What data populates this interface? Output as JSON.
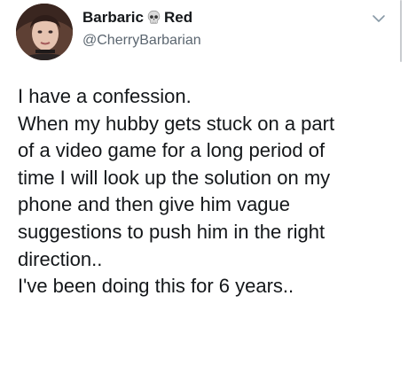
{
  "user": {
    "display_name_first": "Barbaric",
    "display_name_second": "Red",
    "handle": "@CherryBarbarian",
    "name_emoji": "skull-icon"
  },
  "tweet": {
    "lines": [
      "I have a confession.",
      "When my hubby gets stuck on a part",
      "of a video game for a long period of",
      "time I will look up the solution on my",
      "phone and then give him vague",
      "suggestions to push him in the right",
      "direction..",
      "I've been doing this for 6 years.."
    ]
  },
  "icons": {
    "menu": "chevron-down-icon"
  },
  "colors": {
    "text": "#14171a",
    "secondary": "#5b6670",
    "background": "#ffffff"
  }
}
